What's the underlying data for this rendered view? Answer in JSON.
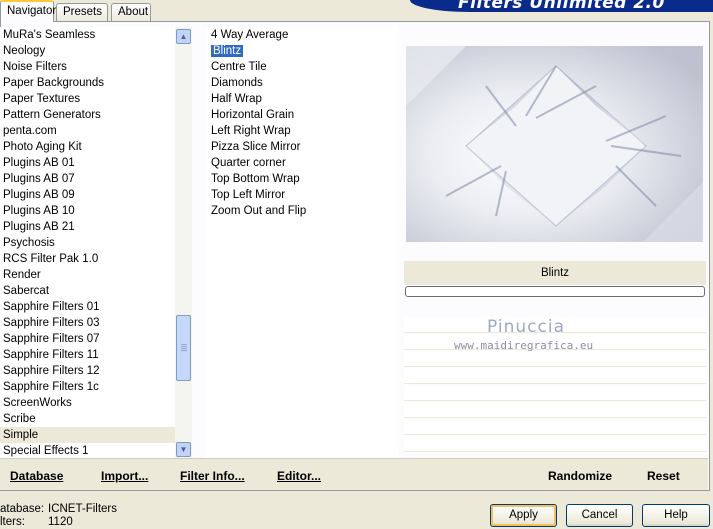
{
  "tabs": [
    {
      "label": "Navigator"
    },
    {
      "label": "Presets"
    },
    {
      "label": "About"
    }
  ],
  "banner_title": "Filters Unlimited 2.0",
  "categories": [
    "MuRa's Seamless",
    "Neology",
    "Noise Filters",
    "Paper Backgrounds",
    "Paper Textures",
    "Pattern Generators",
    "penta.com",
    "Photo Aging Kit",
    "Plugins AB 01",
    "Plugins AB 07",
    "Plugins AB 09",
    "Plugins AB 10",
    "Plugins AB 21",
    "Psychosis",
    "RCS Filter Pak 1.0",
    "Render",
    "Sabercat",
    "Sapphire Filters 01",
    "Sapphire Filters 03",
    "Sapphire Filters 07",
    "Sapphire Filters 11",
    "Sapphire Filters 12",
    "Sapphire Filters 1c",
    "ScreenWorks",
    "Scribe",
    "Simple",
    "Special Effects 1"
  ],
  "selected_category": "Simple",
  "filters": [
    "4 Way Average",
    "Blintz",
    "Centre Tile",
    "Diamonds",
    "Half Wrap",
    "Horizontal Grain",
    "Left Right Wrap",
    "Pizza Slice Mirror",
    "Quarter corner",
    "Top Bottom Wrap",
    "Top Left Mirror",
    "Zoom Out and Flip"
  ],
  "selected_filter": "Blintz",
  "preview": {
    "filter_name": "Blintz",
    "progress_fraction": 0.0
  },
  "watermark": {
    "name": "Pinuccia",
    "url": "www.maidiregrafica.eu"
  },
  "bottom_links": {
    "database": "Database",
    "import": "Import...",
    "filter_info": "Filter Info...",
    "editor": "Editor...",
    "randomize": "Randomize",
    "reset": "Reset"
  },
  "status": {
    "database_label": "atabase:",
    "database_value": "ICNET-Filters",
    "filters_label": "lters:",
    "filters_value": "1120"
  },
  "buttons": {
    "apply": "Apply",
    "cancel": "Cancel",
    "help": "Help"
  },
  "colors": {
    "dialog_bg": "#ece9d8",
    "selection_blue": "#316ac5",
    "banner_blue": "#0a2a8c",
    "tab_highlight": "#ffc83c"
  }
}
